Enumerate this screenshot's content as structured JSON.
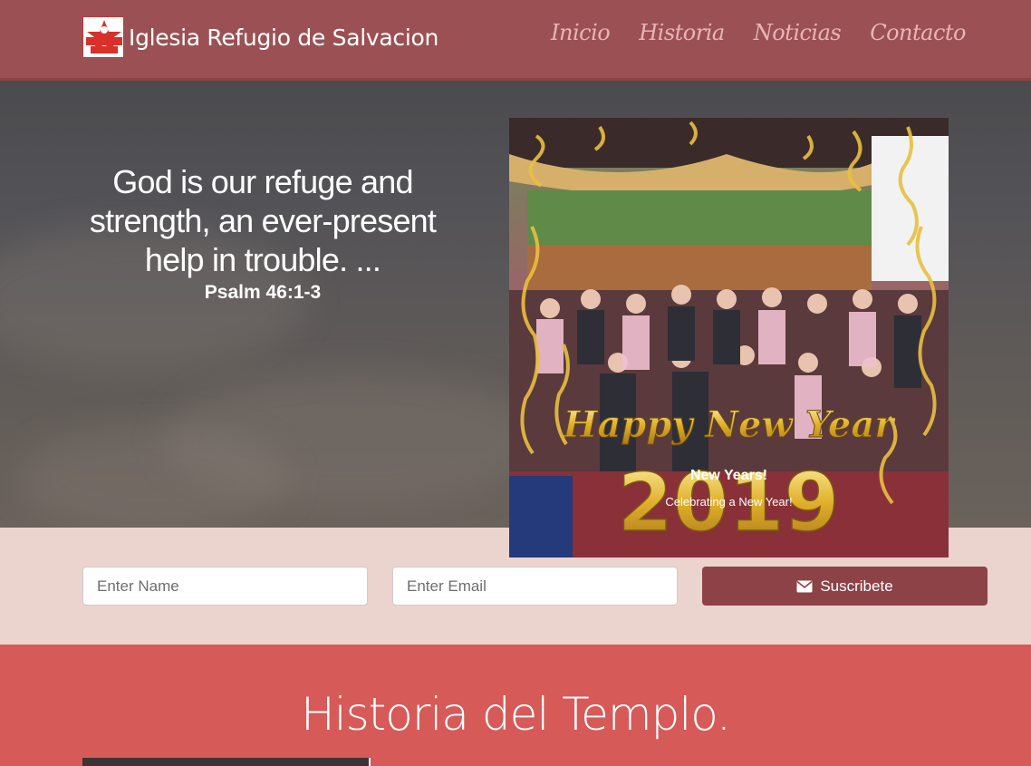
{
  "header": {
    "brand": "Iglesia Refugio de Salvacion",
    "logo_text": "EL REFUGIO DE DAVID",
    "nav": [
      "Inicio",
      "Historia",
      "Noticias",
      "Contacto"
    ]
  },
  "hero": {
    "quote": "God is our refuge and strength, an ever-present help in trouble. ...",
    "reference": "Psalm 46:1-3"
  },
  "carousel": {
    "banner_text": "Happy New Year",
    "banner_year": "2019",
    "caption_title": "New Years!",
    "caption_text": "Celebrating a New Year!",
    "slide_count": 2,
    "active_slide": 2
  },
  "subscribe": {
    "name_placeholder": "Enter Name",
    "email_placeholder": "Enter Email",
    "button_label": "Suscribete"
  },
  "historia": {
    "title": "Historia del Templo."
  },
  "colors": {
    "navbar": "#9b5154",
    "accent_button": "#8c4246",
    "subscribe_bg": "#ebd4ce",
    "section_bg": "#d65a58"
  }
}
